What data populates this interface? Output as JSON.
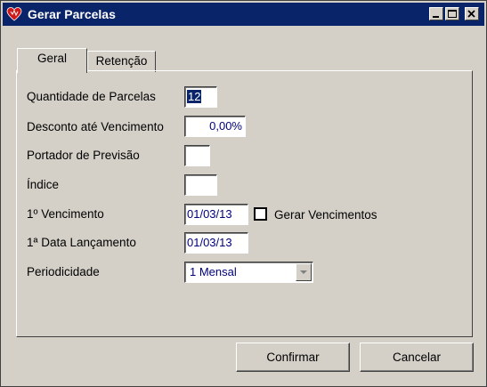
{
  "window": {
    "title": "Gerar Parcelas"
  },
  "tabs": [
    {
      "label": "Geral"
    },
    {
      "label": "Retenção"
    }
  ],
  "form": {
    "quantidade_label": "Quantidade de Parcelas",
    "quantidade_value": "12",
    "desconto_label": "Desconto até Vencimento",
    "desconto_value": "0,00%",
    "portador_label": "Portador de Previsão",
    "portador_value": "",
    "indice_label": "Índice",
    "indice_value": "",
    "vencimento_label": "1º Vencimento",
    "vencimento_value": "01/03/13",
    "gerar_vencimentos_label": "Gerar Vencimentos",
    "gerar_vencimentos_checked": false,
    "data_lancamento_label": "1ª Data Lançamento",
    "data_lancamento_value": "01/03/13",
    "periodicidade_label": "Periodicidade",
    "periodicidade_value": "1  Mensal"
  },
  "buttons": {
    "confirmar": "Confirmar",
    "cancelar": "Cancelar"
  },
  "icons": {
    "app": "heart-icon",
    "minimize": "minimize-icon",
    "maximize": "maximize-icon",
    "close": "close-icon",
    "dropdown": "chevron-down-icon"
  },
  "colors": {
    "titlebar": "#0a246a",
    "field_text": "#00007a",
    "background": "#d4d0c8"
  }
}
